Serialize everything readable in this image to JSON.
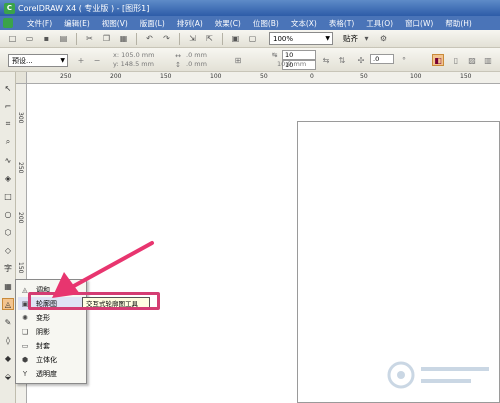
{
  "window": {
    "title": "CorelDRAW X4 ( 专业版 ) - [图形1]"
  },
  "menubar": {
    "items": [
      "文件(F)",
      "编辑(E)",
      "视图(V)",
      "版面(L)",
      "排列(A)",
      "效果(C)",
      "位图(B)",
      "文本(X)",
      "表格(T)",
      "工具(O)",
      "窗口(W)",
      "帮助(H)"
    ]
  },
  "toolbar": {
    "zoom": "100%",
    "snap": "贴齐"
  },
  "property_bar": {
    "preset": "预设...",
    "x": "x: 105.0 mm",
    "y": "y: 148.5 mm",
    "w": ".0 mm",
    "h": ".0 mm",
    "scale_w": "10",
    "scale_h": "10",
    "dup_x": "10.0 mm",
    "dup_y": "10.0 mm",
    "angle": ".0"
  },
  "rulers": {
    "top": [
      "250",
      "200",
      "150",
      "100",
      "50",
      "0",
      "50",
      "100",
      "150",
      "200"
    ],
    "left": [
      "300",
      "250",
      "200",
      "150",
      "100",
      "50"
    ]
  },
  "flyout": {
    "items": [
      {
        "label": "调和",
        "icon": "blend-icon"
      },
      {
        "label": "轮廓图",
        "icon": "contour-icon"
      },
      {
        "label": "变形",
        "icon": "distort-icon"
      },
      {
        "label": "阴影",
        "icon": "drop-shadow-icon"
      },
      {
        "label": "封套",
        "icon": "envelope-icon"
      },
      {
        "label": "立体化",
        "icon": "extrude-icon"
      },
      {
        "label": "透明度",
        "icon": "transparency-icon"
      }
    ],
    "tooltip": "交互式轮廓图工具"
  },
  "colors": {
    "highlight": "#d43d73",
    "arrow": "#e8356f",
    "titlebar": "#2d5ca8"
  }
}
